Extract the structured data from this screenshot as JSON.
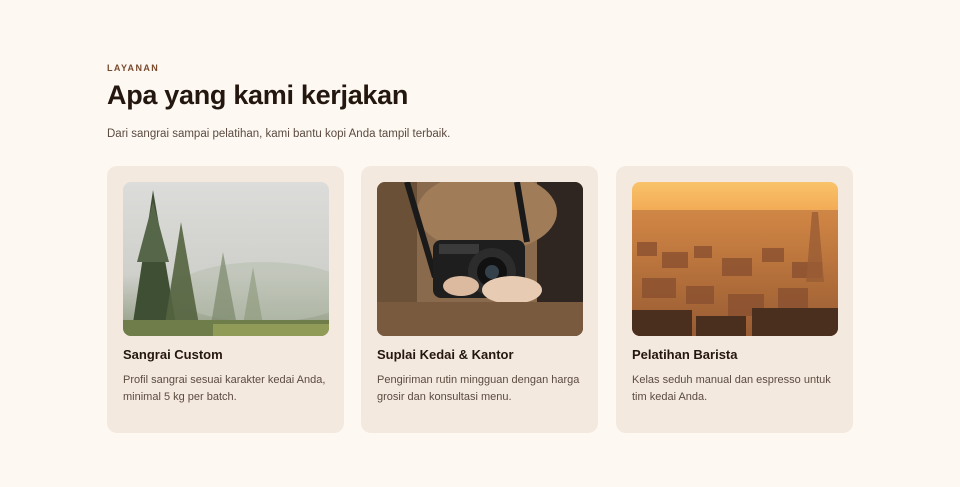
{
  "section": {
    "eyebrow": "LAYANAN",
    "title": "Apa yang kami kerjakan",
    "subtitle": "Dari sangrai sampai pelatihan, kami bantu kopi Anda tampil terbaik."
  },
  "cards": [
    {
      "title": "Sangrai Custom",
      "description": "Profil sangrai sesuai karakter kedai Anda, minimal 5 kg per batch.",
      "image": "misty-pine-forest-photo"
    },
    {
      "title": "Suplai Kedai & Kantor",
      "description": "Pengiriman rutin mingguan dengan harga grosir dan konsultasi menu.",
      "image": "person-holding-camera-photo"
    },
    {
      "title": "Pelatihan Barista",
      "description": "Kelas seduh manual dan espresso untuk tim kedai Anda.",
      "image": "city-sunset-photo"
    }
  ],
  "colors": {
    "background": "#fdf8f2",
    "card": "#f4e9df",
    "eyebrow": "#7a4a2e",
    "heading": "#24170f",
    "body_text": "#5b4b40"
  }
}
